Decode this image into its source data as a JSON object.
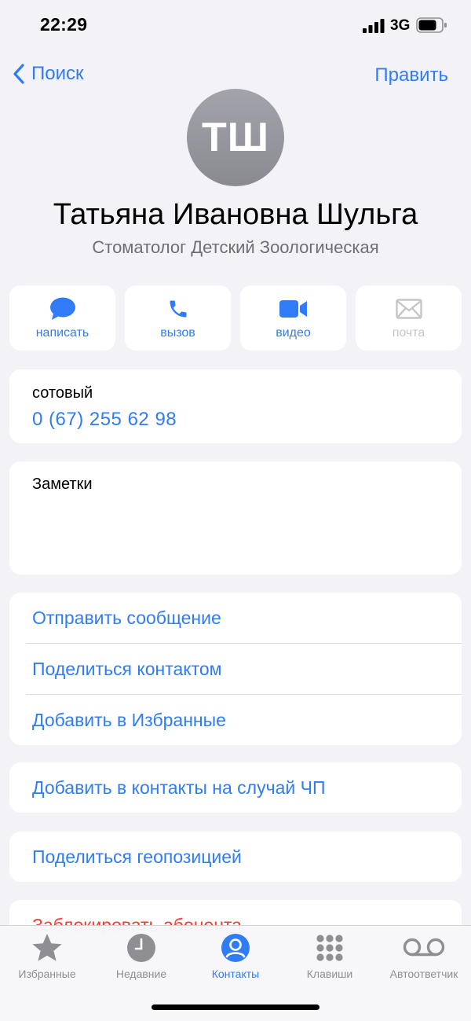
{
  "status_bar": {
    "time": "22:29",
    "network": "3G"
  },
  "nav": {
    "back_label": "Поиск",
    "edit_label": "Править"
  },
  "contact": {
    "initials": "ТШ",
    "name": "Татьяна Ивановна Шульга",
    "subtitle": "Стоматолог Детский Зоологическая"
  },
  "actions": [
    {
      "label": "написать",
      "icon": "message-icon"
    },
    {
      "label": "вызов",
      "icon": "phone-icon"
    },
    {
      "label": "видео",
      "icon": "video-icon"
    },
    {
      "label": "почта",
      "icon": "mail-icon",
      "enabled": false
    }
  ],
  "phone": {
    "label": "сотовый",
    "number": "0 (67) 255 62 98"
  },
  "notes": {
    "label": "Заметки"
  },
  "links_group": [
    {
      "label": "Отправить сообщение"
    },
    {
      "label": "Поделиться контактом"
    },
    {
      "label": "Добавить в Избранные"
    }
  ],
  "emergency": {
    "label": "Добавить в контакты на случай ЧП"
  },
  "location": {
    "label": "Поделиться геопозицией"
  },
  "block": {
    "label": "Заблокировать абонента"
  },
  "tabs": [
    {
      "label": "Избранные",
      "icon": "star-icon"
    },
    {
      "label": "Недавние",
      "icon": "clock-icon"
    },
    {
      "label": "Контакты",
      "icon": "contacts-icon",
      "active": true
    },
    {
      "label": "Клавиши",
      "icon": "keypad-icon"
    },
    {
      "label": "Автоответчик",
      "icon": "voicemail-icon"
    }
  ],
  "colors": {
    "accent": "#2f7cf6",
    "danger": "#ff3b30",
    "background": "#f2f2f7",
    "inactive": "#8e8e93"
  }
}
